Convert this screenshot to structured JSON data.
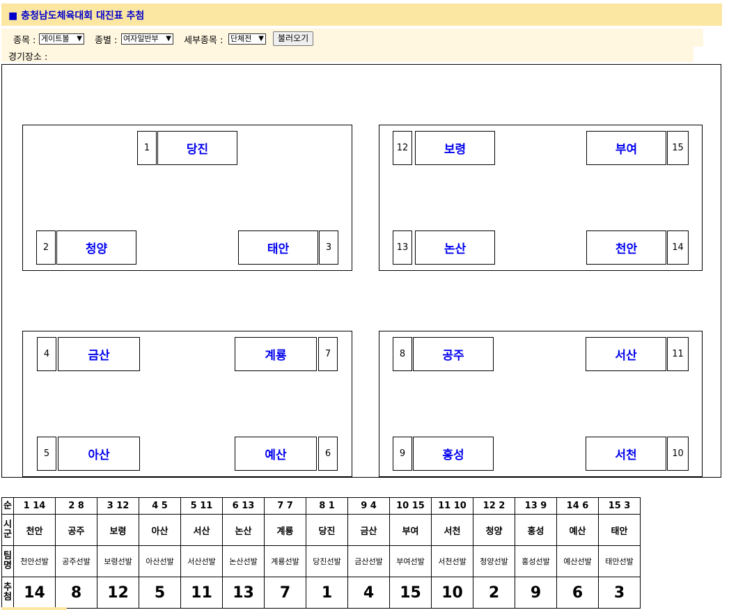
{
  "title": "■ 충청남도체육대회 대진표 추첨",
  "controls": {
    "event_label": "종목 :",
    "event_value": "게이트볼",
    "gender_label": "종별 :",
    "gender_value": "여자일반부",
    "sub_label": "세부종목 :",
    "sub_value": "단체전",
    "load_button": "불러오기"
  },
  "venue_label": "경기장소 :",
  "groups": [
    {
      "slots": [
        {
          "num": "1",
          "team": "당진"
        },
        {
          "num": "2",
          "team": "청양"
        },
        {
          "num": "3",
          "team": "태안"
        }
      ]
    },
    {
      "slots": [
        {
          "num": "12",
          "team": "보령"
        },
        {
          "num": "15",
          "team": "부여"
        },
        {
          "num": "13",
          "team": "논산"
        },
        {
          "num": "14",
          "team": "천안"
        }
      ]
    },
    {
      "slots": [
        {
          "num": "4",
          "team": "금산"
        },
        {
          "num": "7",
          "team": "계룡"
        },
        {
          "num": "5",
          "team": "아산"
        },
        {
          "num": "6",
          "team": "예산"
        }
      ]
    },
    {
      "slots": [
        {
          "num": "8",
          "team": "공주"
        },
        {
          "num": "11",
          "team": "서산"
        },
        {
          "num": "9",
          "team": "홍성"
        },
        {
          "num": "10",
          "team": "서천"
        }
      ]
    }
  ],
  "table": {
    "row_headers": [
      "순",
      "시군",
      "팀명",
      "추첨"
    ],
    "columns": [
      {
        "order": "1 14",
        "city": "천안",
        "team": "천안선발",
        "draw": "14"
      },
      {
        "order": "2 8",
        "city": "공주",
        "team": "공주선발",
        "draw": "8"
      },
      {
        "order": "3 12",
        "city": "보령",
        "team": "보령선발",
        "draw": "12"
      },
      {
        "order": "4 5",
        "city": "아산",
        "team": "아산선발",
        "draw": "5"
      },
      {
        "order": "5 11",
        "city": "서산",
        "team": "서산선발",
        "draw": "11"
      },
      {
        "order": "6 13",
        "city": "논산",
        "team": "논산선발",
        "draw": "13"
      },
      {
        "order": "7 7",
        "city": "계룡",
        "team": "계룡선발",
        "draw": "7"
      },
      {
        "order": "8 1",
        "city": "당진",
        "team": "당진선발",
        "draw": "1"
      },
      {
        "order": "9 4",
        "city": "금산",
        "team": "금산선발",
        "draw": "4"
      },
      {
        "order": "10 15",
        "city": "부여",
        "team": "부여선발",
        "draw": "15"
      },
      {
        "order": "11 10",
        "city": "서천",
        "team": "서천선발",
        "draw": "10"
      },
      {
        "order": "12 2",
        "city": "청양",
        "team": "청양선발",
        "draw": "2"
      },
      {
        "order": "13 9",
        "city": "홍성",
        "team": "홍성선발",
        "draw": "9"
      },
      {
        "order": "14 6",
        "city": "예산",
        "team": "예산선발",
        "draw": "6"
      },
      {
        "order": "15 3",
        "city": "태안",
        "team": "태안선발",
        "draw": "3"
      }
    ]
  }
}
